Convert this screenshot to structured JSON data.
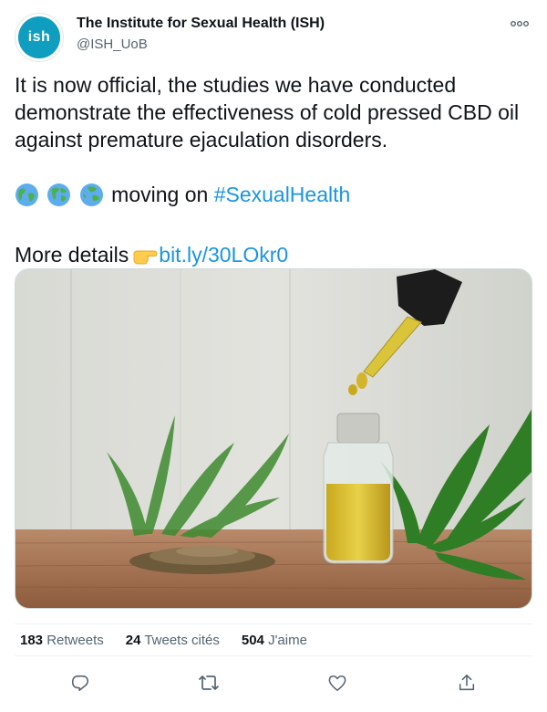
{
  "author": {
    "avatar_text": "ish",
    "name": "The Institute for Sexual Health (ISH)",
    "handle": "@ISH_UoB"
  },
  "tweet": {
    "line1": "It is now official, the studies we have conducted",
    "line2": "demonstrate the effectiveness of cold pressed CBD oil",
    "line3": "against premature ejaculation disorders.",
    "moving_text": "moving on",
    "hashtag": "#SexualHealth",
    "details_text": "More details",
    "link": "bit.ly/30LOkr0"
  },
  "stats": {
    "retweets_count": "183",
    "retweets_label": "Retweets",
    "quotes_count": "24",
    "quotes_label": "Tweets cités",
    "likes_count": "504",
    "likes_label": "J'aime"
  },
  "icons": {
    "more": "more-dots-icon",
    "reply": "reply-icon",
    "retweet": "retweet-icon",
    "like": "heart-icon",
    "share": "share-icon",
    "globe": "globe-emoji-icon",
    "pointing": "pointing-right-emoji-icon"
  },
  "colors": {
    "link": "#1b95e0",
    "avatar": "#0f9ec0",
    "text": "#0f1419",
    "secondary": "#536471"
  }
}
